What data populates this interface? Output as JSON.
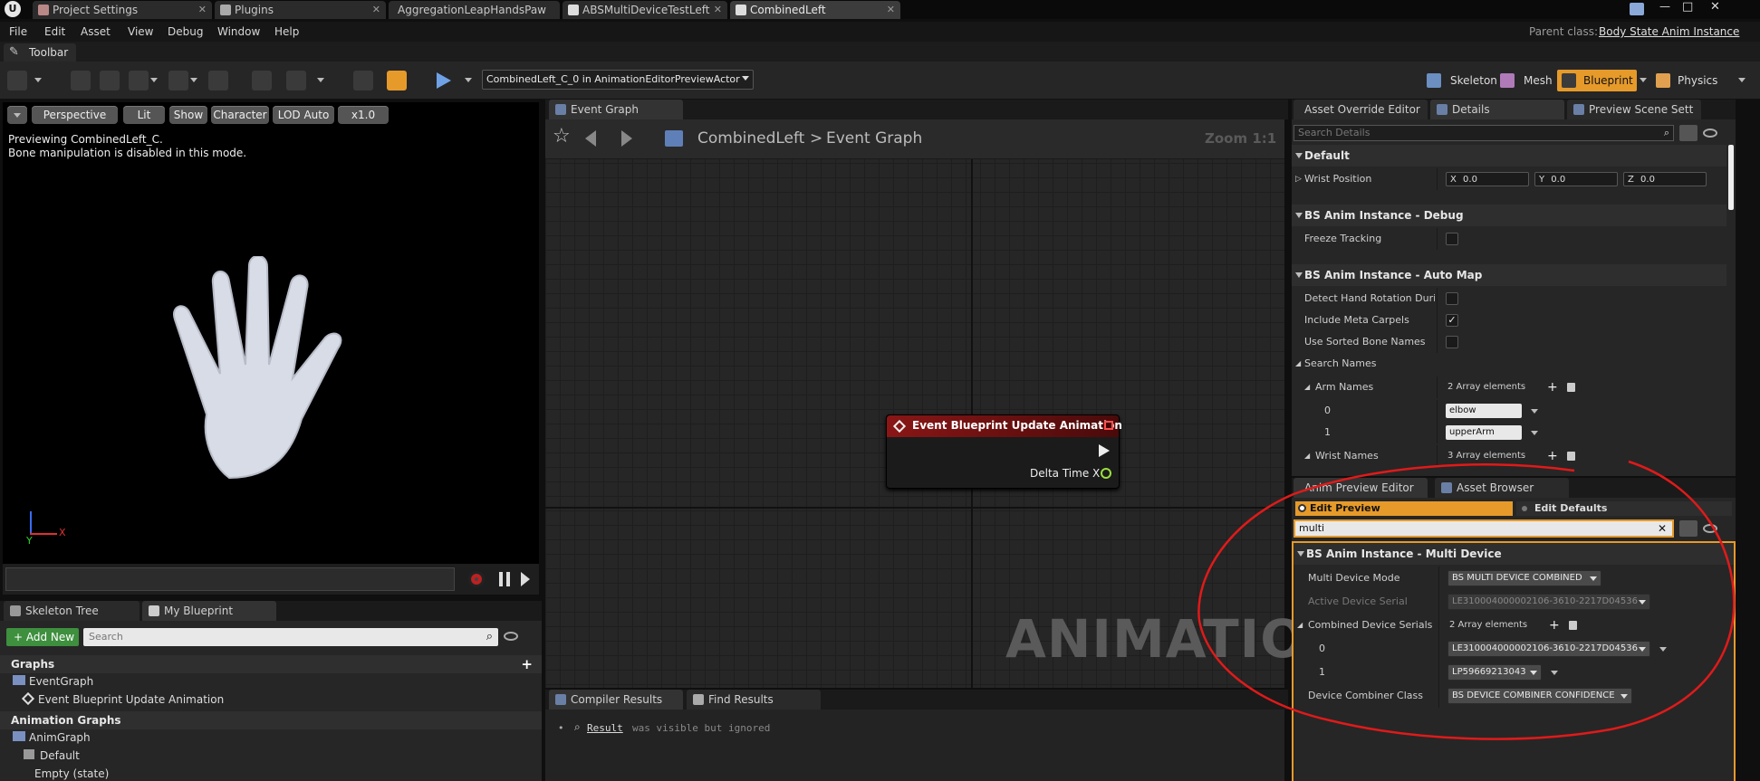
{
  "window": {
    "tabs": [
      {
        "label": "Project Settings"
      },
      {
        "label": "Plugins"
      },
      {
        "label": "AggregationLeapHandsPaw"
      },
      {
        "label": "ABSMultiDeviceTestLeft"
      },
      {
        "label": "CombinedLeft"
      }
    ],
    "parent_class_label": "Parent class:",
    "parent_class_value": "Body State Anim Instance",
    "controls": {
      "min": "—",
      "max": "□",
      "close": "✕"
    }
  },
  "menubar": {
    "items": [
      "File",
      "Edit",
      "Asset",
      "View",
      "Debug",
      "Window",
      "Help"
    ]
  },
  "toolbar": {
    "tab_label": "Toolbar",
    "preview_actor": "CombinedLeft_C_0 in AnimationEditorPreviewActor",
    "modes": {
      "skeleton": "Skeleton",
      "mesh": "Mesh",
      "blueprint": "Blueprint",
      "physics": "Physics"
    }
  },
  "viewport": {
    "perspective": "Perspective",
    "lit": "Lit",
    "show": "Show",
    "character": "Character",
    "lod": "LOD Auto",
    "speed": "x1.0",
    "info1": "Previewing CombinedLeft_C.",
    "info2": "Bone manipulation is disabled in this mode.",
    "axis_x": "X",
    "axis_y": "Y"
  },
  "graph": {
    "tab": "Event Graph",
    "breadcrumb_root": "CombinedLeft",
    "breadcrumb_sep": ">",
    "breadcrumb_leaf": "Event Graph",
    "zoom": "Zoom 1:1",
    "watermark": "ANIMATION",
    "node": {
      "title": "Event Blueprint Update Animation",
      "pin": "Delta Time X"
    }
  },
  "bottom_left": {
    "tabs": [
      "Skeleton Tree",
      "My Blueprint"
    ],
    "add_new": "Add New",
    "search_placeholder": "Search",
    "graphs_header": "Graphs",
    "event_graph": "EventGraph",
    "event_item": "Event Blueprint Update Animation",
    "anim_graphs_header": "Animation Graphs",
    "anim_graph": "AnimGraph",
    "default": "Default",
    "empty_state": "Empty (state)"
  },
  "results": {
    "tabs": [
      "Compiler Results",
      "Find Results"
    ],
    "bullet": "•",
    "result_link": "Result",
    "result_text": "was visible but ignored"
  },
  "details": {
    "tabs": [
      "Asset Override Editor",
      "Details",
      "Preview Scene Sett"
    ],
    "search_placeholder": "Search Details",
    "sections": {
      "default": "Default",
      "debug": "BS Anim Instance - Debug",
      "automap": "BS Anim Instance - Auto Map"
    },
    "wrist_position": "Wrist Position",
    "x_label": "X",
    "x_value": "0.0",
    "y_label": "Y",
    "y_value": "0.0",
    "z_label": "Z",
    "z_value": "0.0",
    "freeze_tracking": "Freeze Tracking",
    "detect_hand": "Detect Hand Rotation During A",
    "include_meta": "Include Meta Carpels",
    "use_sorted": "Use Sorted Bone Names",
    "search_names": "Search Names",
    "arm_names": "Arm Names",
    "arm_count": "2 Array elements",
    "arm0_idx": "0",
    "arm0": "elbow",
    "arm1_idx": "1",
    "arm1": "upperArm",
    "wrist_names": "Wrist Names",
    "wrist_count": "3 Array elements"
  },
  "anim_preview": {
    "tabs": [
      "Anim Preview Editor",
      "Asset Browser"
    ],
    "edit_preview": "Edit Preview",
    "edit_defaults": "Edit Defaults",
    "search_value": "multi",
    "section": "BS Anim Instance - Multi Device",
    "multi_device_mode_label": "Multi Device Mode",
    "multi_device_mode_value": "BS MULTI DEVICE COMBINED",
    "active_serial_label": "Active Device Serial",
    "active_serial_value": "LE310004000002106-3610-2217D04536",
    "combined_label": "Combined Device Serials",
    "combined_count": "2 Array elements",
    "idx0": "0",
    "serial0": "LE310004000002106-3610-2217D04536",
    "idx1": "1",
    "serial1": "LP59669213043",
    "combiner_label": "Device Combiner Class",
    "combiner_value": "BS DEVICE COMBINER CONFIDENCE"
  },
  "colors": {
    "accent_orange": "#e69a2a",
    "annotation_red": "#e01a1a",
    "node_red": "#7a1414"
  }
}
